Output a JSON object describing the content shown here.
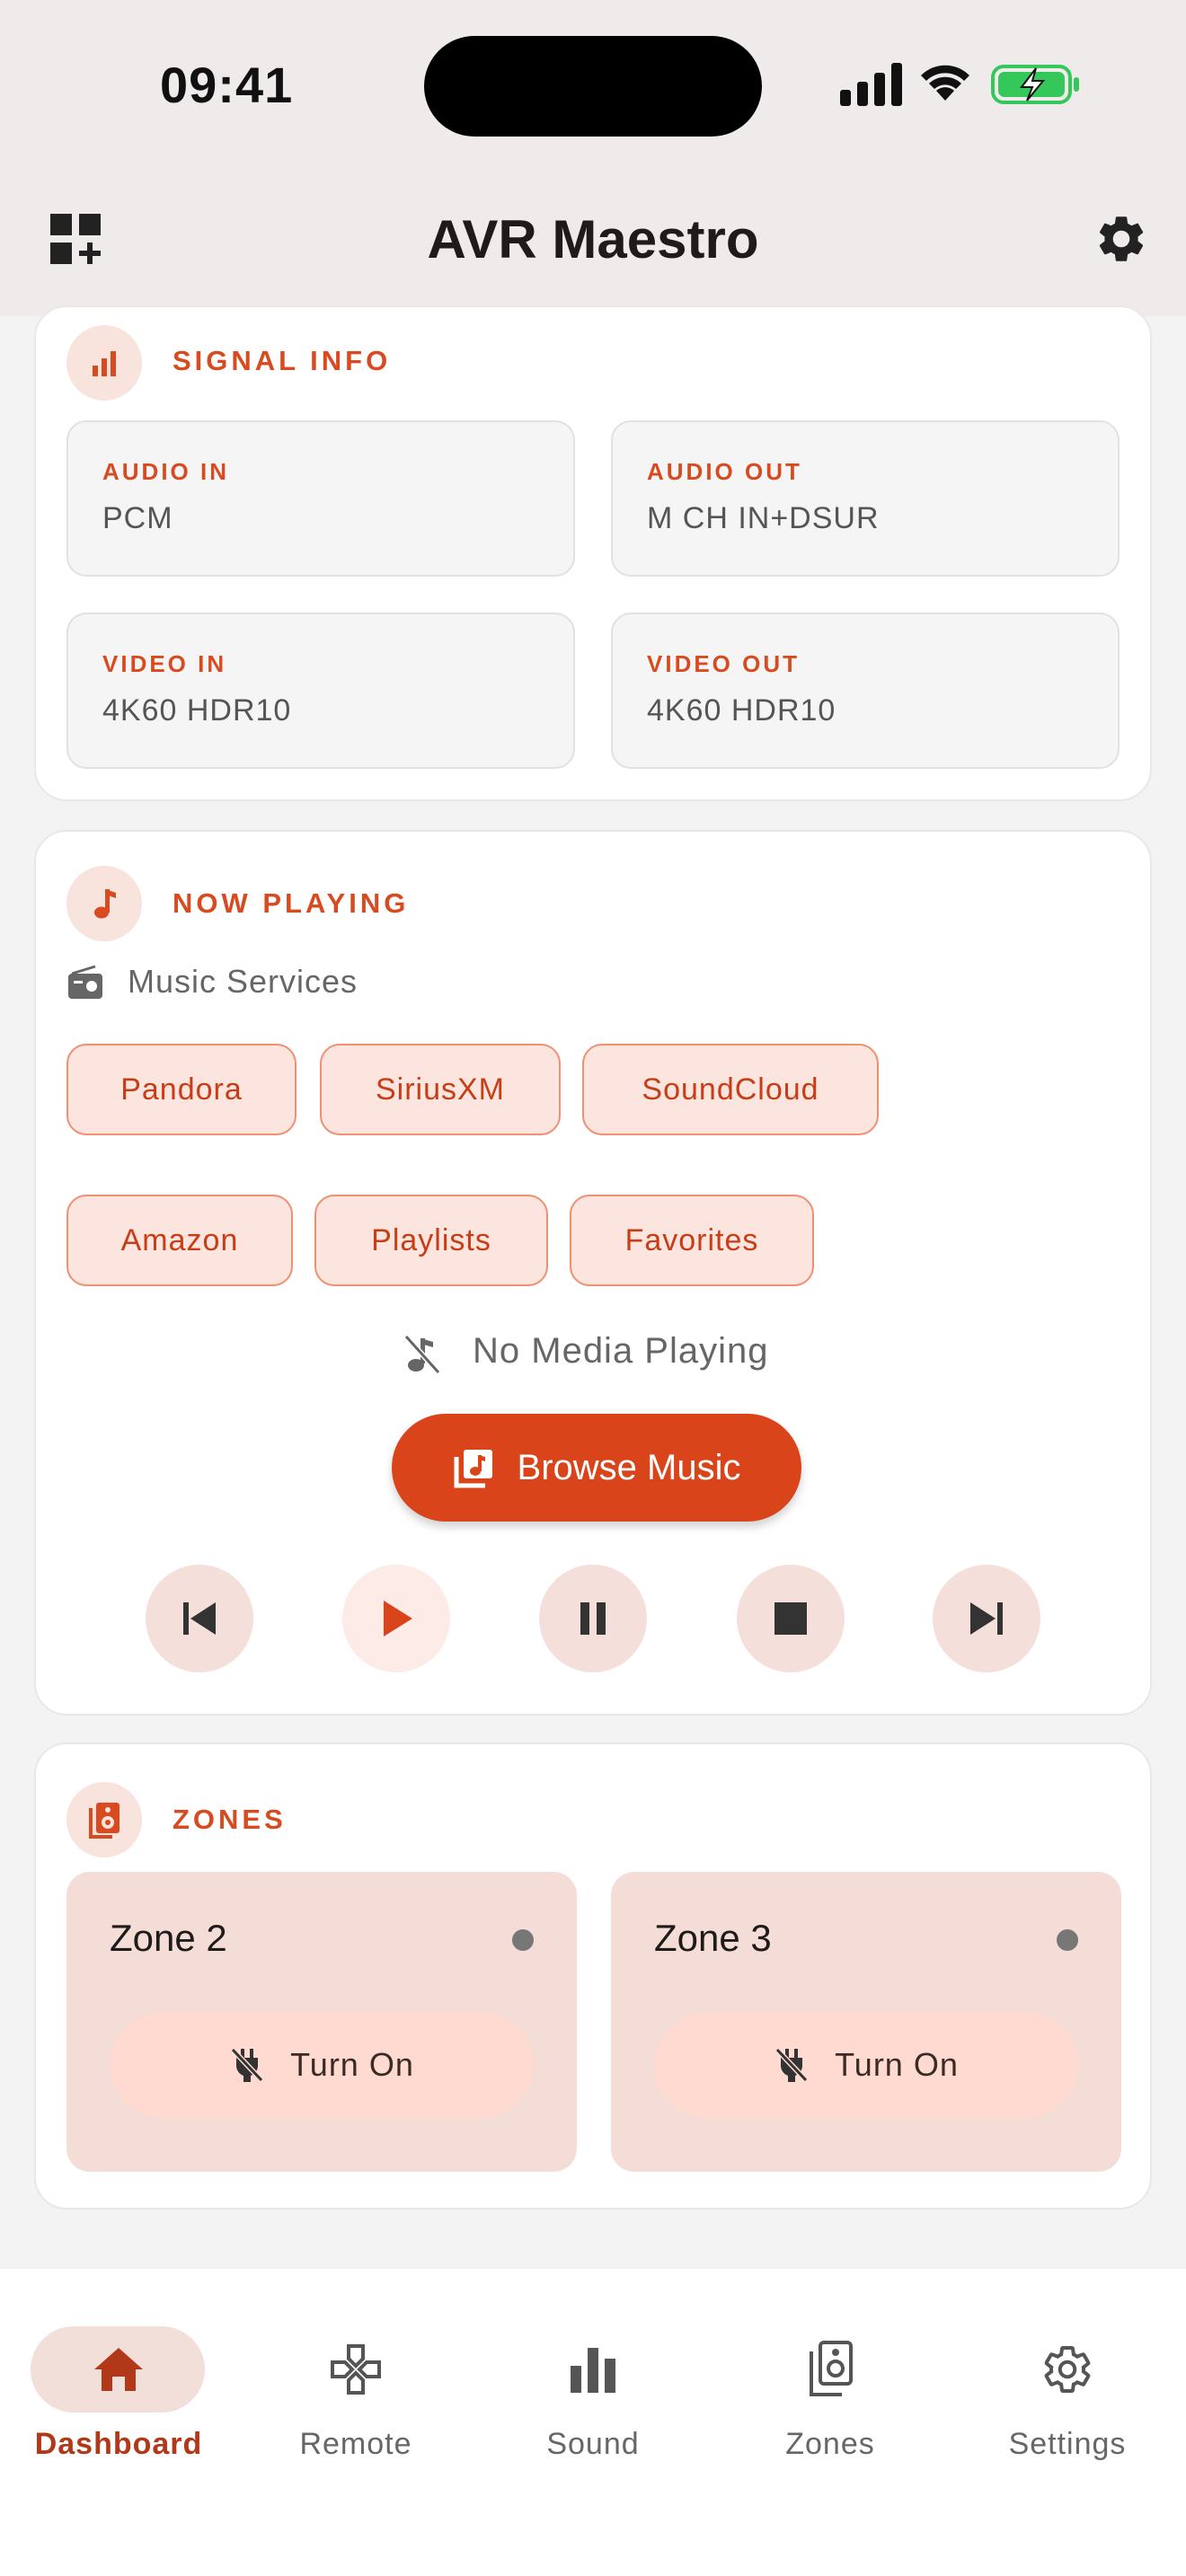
{
  "status_bar": {
    "time": "09:41"
  },
  "app_bar": {
    "title": "AVR Maestro"
  },
  "signal_info": {
    "title": "SIGNAL INFO",
    "tiles": [
      {
        "label": "AUDIO IN",
        "value": "PCM"
      },
      {
        "label": "AUDIO OUT",
        "value": "M CH IN+DSUR"
      },
      {
        "label": "VIDEO IN",
        "value": "4K60 HDR10"
      },
      {
        "label": "VIDEO OUT",
        "value": "4K60 HDR10"
      }
    ]
  },
  "now_playing": {
    "title": "NOW PLAYING",
    "services_label": "Music Services",
    "services": [
      "Pandora",
      "SiriusXM",
      "SoundCloud",
      "Amazon",
      "Playlists",
      "Favorites"
    ],
    "status": "No Media Playing",
    "browse_label": "Browse Music",
    "accent": "#d9441a"
  },
  "zones": {
    "title": "ZONES",
    "items": [
      {
        "name": "Zone 2",
        "action": "Turn On"
      },
      {
        "name": "Zone 3",
        "action": "Turn On"
      }
    ]
  },
  "bottom_nav": {
    "items": [
      {
        "label": "Dashboard",
        "icon": "home-icon",
        "active": true
      },
      {
        "label": "Remote",
        "icon": "gamepad-icon",
        "active": false
      },
      {
        "label": "Sound",
        "icon": "equalizer-icon",
        "active": false
      },
      {
        "label": "Zones",
        "icon": "speaker-icon",
        "active": false
      },
      {
        "label": "Settings",
        "icon": "gear-icon",
        "active": false
      }
    ]
  }
}
